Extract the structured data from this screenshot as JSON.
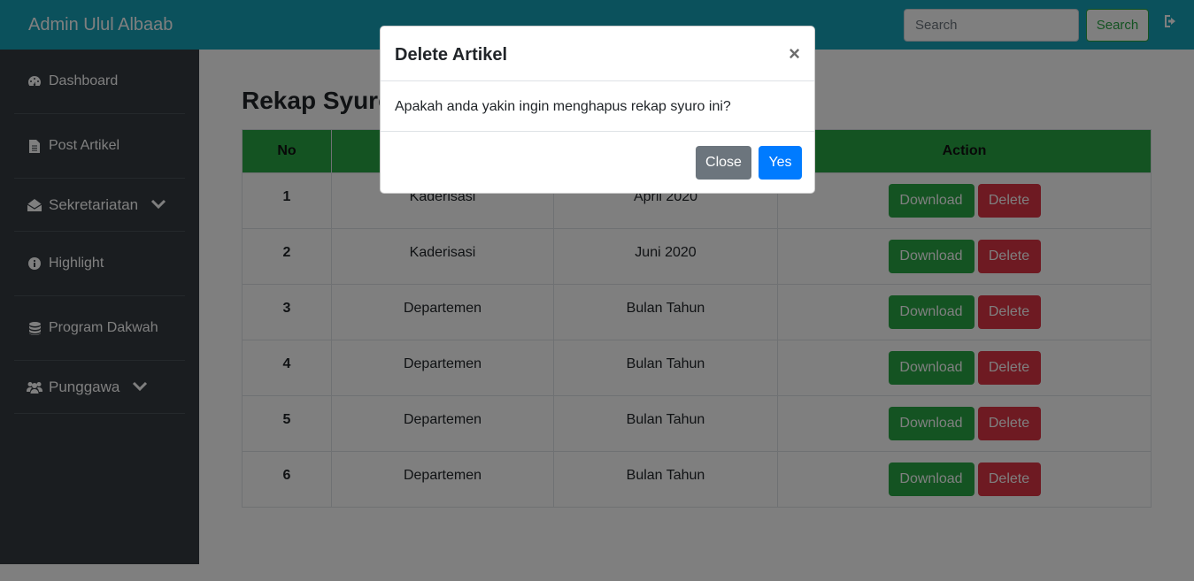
{
  "navbar": {
    "brand": "Admin Ulul Albaab",
    "search_placeholder": "Search",
    "search_button": "Search",
    "logout_icon": "sign-out-icon"
  },
  "sidebar": {
    "items": [
      {
        "label": "Dashboard",
        "icon": "tachometer-icon"
      },
      {
        "label": "Post Artikel",
        "icon": "file-icon"
      },
      {
        "label": "Sekretariatan",
        "icon": "envelope-open-icon",
        "has_dropdown": true
      },
      {
        "label": "Highlight",
        "icon": "info-circle-icon"
      },
      {
        "label": "Program Dakwah",
        "icon": "database-icon"
      },
      {
        "label": "Punggawa",
        "icon": "users-icon",
        "has_dropdown": true
      }
    ]
  },
  "main": {
    "title": "Rekap Syuro",
    "table": {
      "headers": [
        "No",
        "",
        "",
        "Action"
      ],
      "rows": [
        {
          "no": "1",
          "col2": "Kaderisasi",
          "col3": "April 2020"
        },
        {
          "no": "2",
          "col2": "Kaderisasi",
          "col3": "Juni 2020"
        },
        {
          "no": "3",
          "col2": "Departemen",
          "col3": "Bulan Tahun"
        },
        {
          "no": "4",
          "col2": "Departemen",
          "col3": "Bulan Tahun"
        },
        {
          "no": "5",
          "col2": "Departemen",
          "col3": "Bulan Tahun"
        },
        {
          "no": "6",
          "col2": "Departemen",
          "col3": "Bulan Tahun"
        }
      ],
      "download_label": "Download",
      "delete_label": "Delete"
    }
  },
  "modal": {
    "title": "Delete Artikel",
    "close_glyph": "×",
    "body": "Apakah anda yakin ingin menghapus rekap syuro ini?",
    "close_button": "Close",
    "yes_button": "Yes"
  },
  "colors": {
    "navbar": "#17a2b8",
    "sidebar": "#343a40",
    "success": "#28a745",
    "danger": "#dc3545",
    "primary": "#007bff",
    "secondary": "#6c757d"
  }
}
